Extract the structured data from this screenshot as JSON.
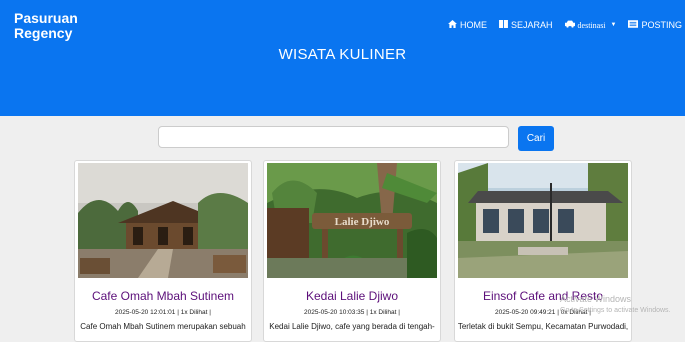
{
  "navbar": {
    "brand": "Pasuruan Regency",
    "items": [
      {
        "icon": "home-icon",
        "label": "HOME"
      },
      {
        "icon": "book-icon",
        "label": "SEJARAH"
      },
      {
        "icon": "car-icon",
        "label": "destinasi"
      },
      {
        "icon": "newspaper-icon",
        "label": "POSTING"
      }
    ]
  },
  "hero": {
    "title": "WISATA KULINER"
  },
  "search": {
    "placeholder": "",
    "button_label": "Cari"
  },
  "cards": [
    {
      "title": "Cafe Omah Mbah Sutinem",
      "meta": "2025-05-20 12:01:01 | 1x Dilihat |",
      "desc": "Cafe Omah Mbah Sutinem merupakan sebuah"
    },
    {
      "title": "Kedai Lalie Djiwo",
      "meta": "2025-05-20 10:03:35 | 1x Dilihat |",
      "desc": "Kedai Lalie Djiwo, cafe yang berada di tengah-",
      "sign_text": "Lalie Djiwo"
    },
    {
      "title": "Einsof Cafe and Resto",
      "meta": "2025-05-20 09:49:21 | 0x Dilihat |",
      "desc": "Terletak di bukit Sempu, Kecamatan Purwodadi,"
    }
  ],
  "watermark": {
    "line1": "Activate Windows",
    "line2": "Go to Settings to activate Windows."
  },
  "colors": {
    "primary": "#0a75f0",
    "title": "#5c0f7a",
    "background": "#efefef"
  }
}
